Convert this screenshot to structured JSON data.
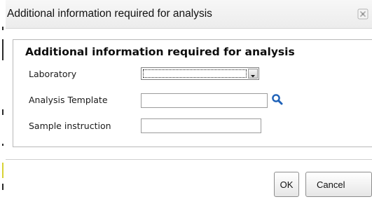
{
  "dialog": {
    "title": "Additional information required for analysis"
  },
  "form": {
    "heading": "Additional information required for analysis",
    "laboratory_label": "Laboratory",
    "laboratory_value": "",
    "template_label": "Analysis Template",
    "template_value": "",
    "instruction_label": "Sample instruction",
    "instruction_value": ""
  },
  "footer": {
    "ok_label": "OK",
    "cancel_label": "Cancel"
  },
  "icons": {
    "close": "close-icon",
    "dropdown": "chevron-down-icon",
    "search": "search-icon"
  },
  "colors": {
    "search_icon": "#1f62b8",
    "title_bar": "#f2f2f2"
  }
}
